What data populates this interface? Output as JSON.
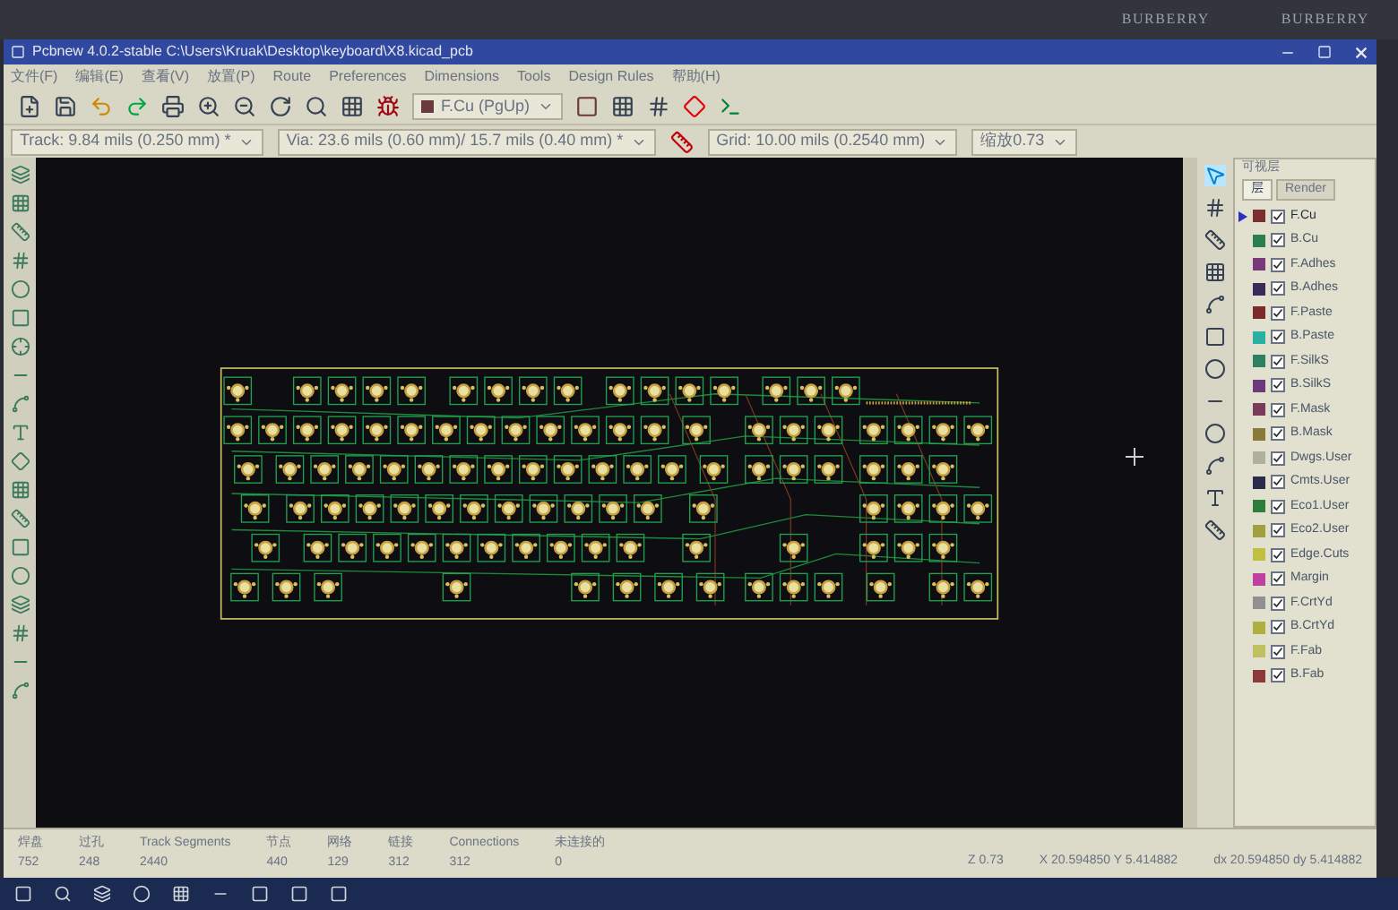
{
  "desktop": {
    "labels": [
      "BURBERRY",
      "BURBERRY"
    ]
  },
  "window": {
    "title": "Pcbnew 4.0.2-stable C:\\Users\\Kruak\\Desktop\\keyboard\\X8.kicad_pcb"
  },
  "menu": [
    "文件(F)",
    "编辑(E)",
    "查看(V)",
    "放置(P)",
    "Route",
    "Preferences",
    "Dimensions",
    "Tools",
    "Design Rules",
    "帮助(H)"
  ],
  "layer_select": {
    "value": "F.Cu (PgUp)",
    "color": "#6b3a3a"
  },
  "toolbar2": {
    "track": "Track: 9.84 mils (0.250 mm) *",
    "via": "Via: 23.6 mils (0.60 mm)/ 15.7 mils (0.40 mm) *",
    "grid": "Grid: 10.00 mils (0.2540 mm)",
    "zoom": "缩放0.73"
  },
  "layers_panel": {
    "title": "可视层",
    "tabs": [
      {
        "label": "层",
        "selected": true
      },
      {
        "label": "Render",
        "selected": false
      }
    ],
    "layers": [
      {
        "name": "F.Cu",
        "checked": true,
        "selected": true,
        "color": "#7a3030"
      },
      {
        "name": "B.Cu",
        "checked": true,
        "selected": false,
        "color": "#2e7d4f"
      },
      {
        "name": "F.Adhes",
        "checked": true,
        "selected": false,
        "color": "#7a3a7a"
      },
      {
        "name": "B.Adhes",
        "checked": true,
        "selected": false,
        "color": "#3a2a5a"
      },
      {
        "name": "F.Paste",
        "checked": true,
        "selected": false,
        "color": "#7a2a2a"
      },
      {
        "name": "B.Paste",
        "checked": true,
        "selected": false,
        "color": "#2ab0a0"
      },
      {
        "name": "F.SilkS",
        "checked": true,
        "selected": false,
        "color": "#2e8060"
      },
      {
        "name": "B.SilkS",
        "checked": true,
        "selected": false,
        "color": "#6a3a7a"
      },
      {
        "name": "F.Mask",
        "checked": true,
        "selected": false,
        "color": "#7a3a5a"
      },
      {
        "name": "B.Mask",
        "checked": true,
        "selected": false,
        "color": "#8a7a3a"
      },
      {
        "name": "Dwgs.User",
        "checked": true,
        "selected": false,
        "color": "#b0b0a0"
      },
      {
        "name": "Cmts.User",
        "checked": true,
        "selected": false,
        "color": "#2a2a4a"
      },
      {
        "name": "Eco1.User",
        "checked": true,
        "selected": false,
        "color": "#2e7d3a"
      },
      {
        "name": "Eco2.User",
        "checked": true,
        "selected": false,
        "color": "#a0a040"
      },
      {
        "name": "Edge.Cuts",
        "checked": true,
        "selected": false,
        "color": "#c0c040"
      },
      {
        "name": "Margin",
        "checked": true,
        "selected": false,
        "color": "#c040a0"
      },
      {
        "name": "F.CrtYd",
        "checked": true,
        "selected": false,
        "color": "#909090"
      },
      {
        "name": "B.CrtYd",
        "checked": true,
        "selected": false,
        "color": "#b0b040"
      },
      {
        "name": "F.Fab",
        "checked": true,
        "selected": false,
        "color": "#c0c060"
      },
      {
        "name": "B.Fab",
        "checked": true,
        "selected": false,
        "color": "#8a3a3a"
      }
    ]
  },
  "status_bar": {
    "stats": [
      {
        "label": "焊盘",
        "value": "752"
      },
      {
        "label": "过孔",
        "value": "248"
      },
      {
        "label": "Track Segments",
        "value": "2440"
      },
      {
        "label": "节点",
        "value": "440"
      },
      {
        "label": "网络",
        "value": "129"
      },
      {
        "label": "链接",
        "value": "312"
      },
      {
        "label": "Connections",
        "value": "312"
      },
      {
        "label": "未连接的",
        "value": "0"
      }
    ],
    "zoom": "Z 0.73",
    "position": "X 20.594850  Y 5.414882",
    "delta": "dx 20.594850  dy 5.414882"
  }
}
